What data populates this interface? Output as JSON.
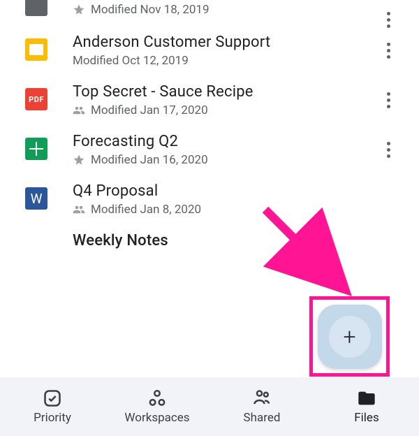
{
  "files": [
    {
      "title": "",
      "modified": "Modified Nov 18, 2019",
      "prefix": "star",
      "type": "gray"
    },
    {
      "title": "Anderson Customer Support",
      "modified": "Modified Oct 12, 2019",
      "prefix": "none",
      "type": "slides"
    },
    {
      "title": "Top Secret - Sauce Recipe",
      "modified": "Modified Jan 17, 2020",
      "prefix": "shared",
      "type": "pdf"
    },
    {
      "title": "Forecasting Q2",
      "modified": "Modified Jan 16, 2020",
      "prefix": "star",
      "type": "sheets"
    },
    {
      "title": "Q4 Proposal",
      "modified": "Modified Jan 8, 2020",
      "prefix": "shared",
      "type": "word"
    },
    {
      "title": "Weekly Notes",
      "modified": "",
      "prefix": "none",
      "type": "gray"
    }
  ],
  "icon_text": {
    "pdf": "PDF",
    "word": "W"
  },
  "fab_label": "+",
  "nav": {
    "priority": "Priority",
    "workspaces": "Workspaces",
    "shared": "Shared",
    "files": "Files"
  }
}
